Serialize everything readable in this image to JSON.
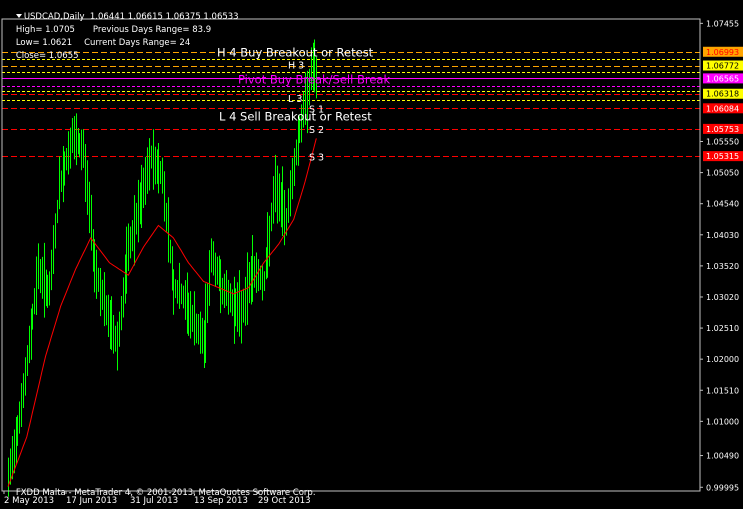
{
  "header": {
    "title_line": "USDCAD,Daily  1.06441 1.06615 1.06375 1.06533",
    "high": "High= 1.0705",
    "prev_range": "Previous Days Range= 83.9",
    "low": "Low= 1.0621",
    "curr_range": "Current Days Range= 24",
    "close": "Close= 1.0655"
  },
  "footer": "FXDD Malta - MetaTrader 4, © 2001-2013, MetaQuotes Software Corp.",
  "colors": {
    "background": "#000000",
    "frame": "#c0c0c0",
    "bull": "#00ff00",
    "bear": "#00ff00",
    "ma": "#ff0000",
    "resistance": "#ffa500",
    "pivot": "#ff00ff",
    "support": "#ff0000"
  },
  "chart_data": {
    "type": "candlestick",
    "symbol": "USDCAD",
    "timeframe": "Daily",
    "x_tick_labels": [
      "2 May 2013",
      "17 Jun 2013",
      "31 Jul 2013",
      "13 Sep 2013",
      "29 Oct 2013"
    ],
    "y_ticks": [
      1.0745,
      1.0555,
      1.0505,
      1.0455,
      1.0405,
      1.0355,
      1.0305,
      1.0255,
      1.0205,
      1.0155,
      1.0105,
      1.005,
      0.9999
    ],
    "y_tick_labels": [
      "1.07455",
      "1.05550",
      "1.05050",
      "1.04540",
      "1.04030",
      "1.03520",
      "1.03020",
      "1.02510",
      "1.02000",
      "1.01510",
      "1.01000",
      "1.00490",
      "0.99995"
    ],
    "ylim": [
      0.9993,
      1.0752
    ],
    "price_levels": [
      {
        "label": "1.06993",
        "value": 1.06993,
        "kind": "resistance",
        "box": "#ffa500",
        "text_color": "#ff0000"
      },
      {
        "label": "1.06772",
        "value": 1.06772,
        "kind": "resistance",
        "box": "#ffff00",
        "text_color": "#000000"
      },
      {
        "label": "1.06565",
        "value": 1.06565,
        "kind": "pivot",
        "box": "#ff00ff",
        "text_color": "#ffffff"
      },
      {
        "label": "1.06318",
        "value": 1.06318,
        "kind": "support",
        "box": "#ffff00",
        "text_color": "#000000"
      },
      {
        "label": "1.06084",
        "value": 1.06084,
        "kind": "support",
        "box": "#ff0000",
        "text_color": "#ffffff"
      },
      {
        "label": "1.05753",
        "value": 1.05753,
        "kind": "support",
        "box": "#ff0000",
        "text_color": "#ffffff"
      },
      {
        "label": "1.05315",
        "value": 1.05315,
        "kind": "support",
        "box": "#ff0000",
        "text_color": "#ffffff"
      }
    ],
    "annotations": [
      {
        "text": "H 4 Buy Breakout or Retest",
        "value": 1.0698,
        "color": "#ffffff"
      },
      {
        "text": "Pivot Buy Break/Sell Break",
        "value": 1.0655,
        "color": "#ff00ff"
      },
      {
        "text": "L 4 Sell Breakout or Retest",
        "value": 1.0595,
        "color": "#ffffff"
      },
      {
        "text": "S 1",
        "value": 1.0608,
        "color": "#ffffff"
      },
      {
        "text": "S 2",
        "value": 1.0575,
        "color": "#ffffff"
      },
      {
        "text": "S 3",
        "value": 1.0531,
        "color": "#ffffff"
      },
      {
        "text": "H 3",
        "value": 1.0679,
        "color": "#ffffff"
      },
      {
        "text": "L 3",
        "value": 1.0625,
        "color": "#ffffff"
      }
    ],
    "candle_anchors": [
      [
        0,
        1.001
      ],
      [
        8,
        1.015
      ],
      [
        16,
        1.035
      ],
      [
        22,
        1.031
      ],
      [
        27,
        1.048
      ],
      [
        34,
        1.056
      ],
      [
        40,
        1.054
      ],
      [
        46,
        1.036
      ],
      [
        52,
        1.028
      ],
      [
        58,
        1.023
      ],
      [
        64,
        1.038
      ],
      [
        70,
        1.045
      ],
      [
        76,
        1.053
      ],
      [
        82,
        1.05
      ],
      [
        88,
        1.032
      ],
      [
        92,
        1.031
      ],
      [
        98,
        1.027
      ],
      [
        104,
        1.023
      ],
      [
        108,
        1.037
      ],
      [
        114,
        1.032
      ],
      [
        118,
        1.03
      ],
      [
        124,
        1.028
      ],
      [
        130,
        1.035
      ],
      [
        136,
        1.033
      ],
      [
        142,
        1.048
      ],
      [
        148,
        1.043
      ],
      [
        154,
        1.056
      ],
      [
        158,
        1.0615
      ],
      [
        162,
        1.068
      ],
      [
        164,
        1.0655
      ]
    ],
    "ma_anchors": [
      [
        0,
        1.0
      ],
      [
        10,
        1.008
      ],
      [
        20,
        1.021
      ],
      [
        28,
        1.029
      ],
      [
        36,
        1.035
      ],
      [
        44,
        1.04
      ],
      [
        54,
        1.036
      ],
      [
        64,
        1.034
      ],
      [
        72,
        1.0385
      ],
      [
        80,
        1.042
      ],
      [
        88,
        1.04
      ],
      [
        96,
        1.036
      ],
      [
        104,
        1.033
      ],
      [
        112,
        1.032
      ],
      [
        120,
        1.031
      ],
      [
        128,
        1.032
      ],
      [
        136,
        1.036
      ],
      [
        144,
        1.039
      ],
      [
        152,
        1.043
      ],
      [
        158,
        1.049
      ],
      [
        164,
        1.056
      ]
    ]
  }
}
